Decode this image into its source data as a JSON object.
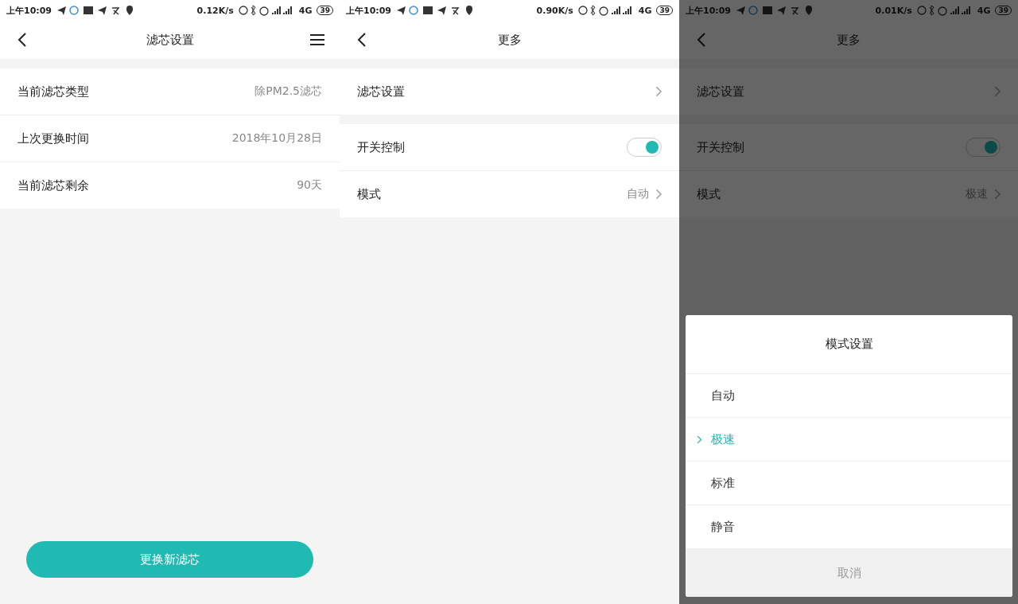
{
  "screens": [
    {
      "status_bar": {
        "time": "上午10:09",
        "speed": "0.12K/s",
        "network": "4G",
        "battery": "39"
      },
      "nav": {
        "title": "滤芯设置",
        "menu": true
      },
      "dimmed": false,
      "groups": [
        {
          "rows": [
            {
              "kind": "info",
              "label": "当前滤芯类型",
              "value": "除PM2.5滤芯"
            },
            {
              "kind": "info",
              "label": "上次更换时间",
              "value": "2018年10月28日"
            },
            {
              "kind": "info",
              "label": "当前滤芯剩余",
              "value": "90天"
            }
          ]
        }
      ],
      "button": "更换新滤芯"
    },
    {
      "status_bar": {
        "time": "上午10:09",
        "speed": "0.90K/s",
        "network": "4G",
        "battery": "39"
      },
      "nav": {
        "title": "更多",
        "menu": false
      },
      "dimmed": false,
      "groups": [
        {
          "rows": [
            {
              "kind": "link",
              "label": "滤芯设置"
            }
          ]
        },
        {
          "rows": [
            {
              "kind": "toggle",
              "label": "开关控制",
              "on": true
            },
            {
              "kind": "select",
              "label": "模式",
              "value": "自动"
            }
          ]
        }
      ]
    },
    {
      "status_bar": {
        "time": "上午10:09",
        "speed": "0.01K/s",
        "network": "4G",
        "battery": "39"
      },
      "nav": {
        "title": "更多",
        "menu": false
      },
      "dimmed": true,
      "groups": [
        {
          "rows": [
            {
              "kind": "link",
              "label": "滤芯设置"
            }
          ]
        },
        {
          "rows": [
            {
              "kind": "toggle",
              "label": "开关控制",
              "on": true
            },
            {
              "kind": "select",
              "label": "模式",
              "value": "极速"
            }
          ]
        }
      ],
      "sheet": {
        "title": "模式设置",
        "options": [
          {
            "label": "自动",
            "selected": false
          },
          {
            "label": "极速",
            "selected": true
          },
          {
            "label": "标准",
            "selected": false
          },
          {
            "label": "静音",
            "selected": false
          }
        ],
        "cancel": "取消"
      }
    }
  ]
}
